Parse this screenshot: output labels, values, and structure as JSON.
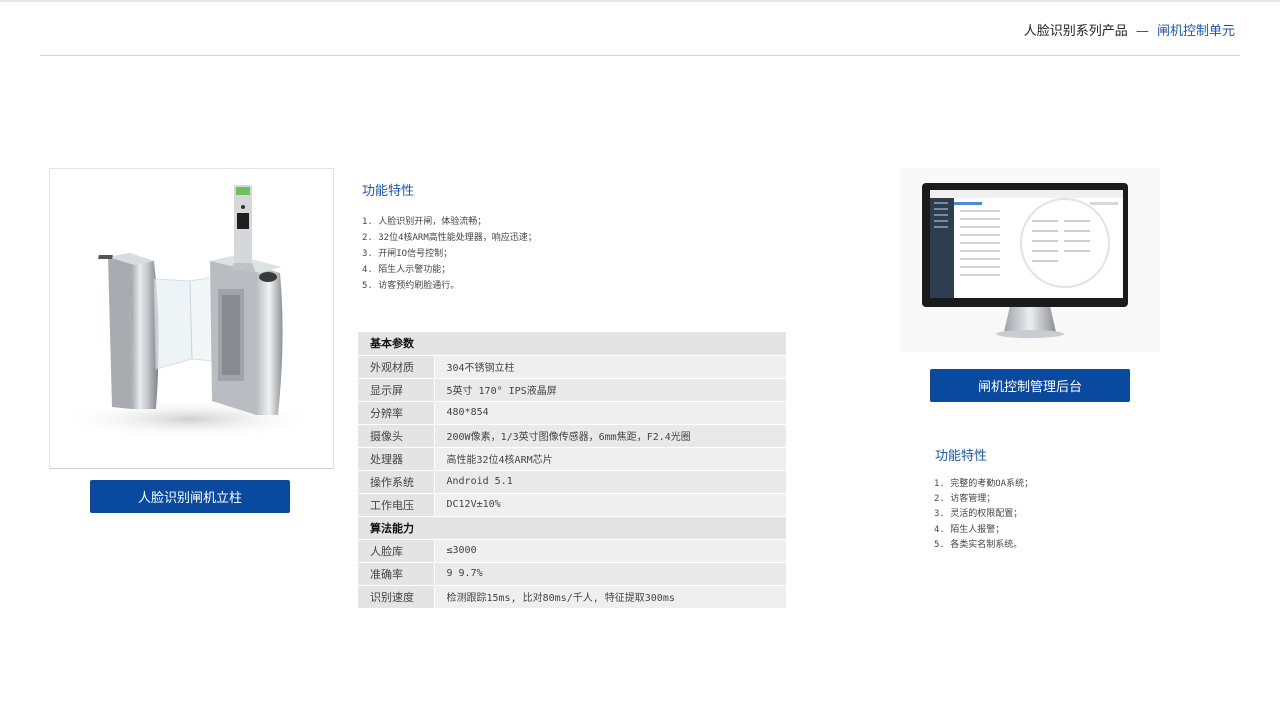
{
  "header": {
    "series": "人脸识别系列产品",
    "dash": "—",
    "subtitle": "闸机控制单元"
  },
  "product": {
    "button_label": "人脸识别闸机立柱"
  },
  "features_left": {
    "title": "功能特性",
    "items": [
      "1. 人脸识别开闸，体验流畅；",
      "2. 32位4核ARM高性能处理器，响应迅速；",
      "3. 开闸IO信号控制；",
      "4. 陌生人示警功能；",
      "5. 访客预约刷脸通行。"
    ]
  },
  "params": {
    "section_basic": "基本参数",
    "basic": [
      {
        "k": "外观材质",
        "v": "304不锈钢立柱"
      },
      {
        "k": "显示屏",
        "v": "5英寸 170° IPS液晶屏"
      },
      {
        "k": "分辨率",
        "v": "480*854"
      },
      {
        "k": "摄像头",
        "v": "200W像素，1/3英寸图像传感器，6mm焦距，F2.4光圈"
      },
      {
        "k": "处理器",
        "v": "高性能32位4核ARM芯片"
      },
      {
        "k": "操作系统",
        "v": "Android 5.1"
      },
      {
        "k": "工作电压",
        "v": "DC12V±10%"
      }
    ],
    "section_algo": "算法能力",
    "algo": [
      {
        "k": "人脸库",
        "v": "≤3000"
      },
      {
        "k": "准确率",
        "v": "9 9.7%"
      },
      {
        "k": "识别速度",
        "v": "检测跟踪15ms, 比对80ms/千人, 特征提取300ms"
      }
    ]
  },
  "backend": {
    "button_label": "闸机控制管理后台"
  },
  "features_right": {
    "title": "功能特性",
    "items": [
      "1. 完整的考勤OA系统；",
      "2. 访客管理；",
      "3. 灵活的权限配置；",
      "4. 陌生人报警；",
      "5. 各类实名制系统。"
    ]
  },
  "colors": {
    "accent": "#1f56a8",
    "button": "#0a4a9e"
  }
}
